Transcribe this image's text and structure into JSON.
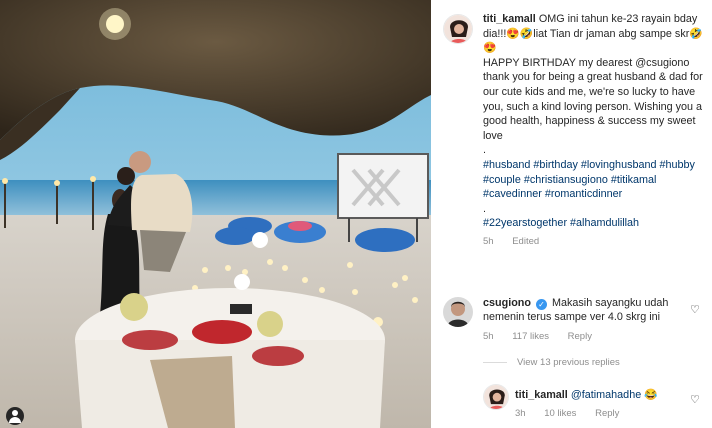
{
  "post": {
    "username": "titi_kamall",
    "caption_lines": [
      "OMG ini tahun ke-23 rayain bday dia!!!😍🤣liat Tian dr jaman abg sampe skr🤣😍",
      "HAPPY BIRTHDAY  my dearest @csugiono thank you for being a great husband & dad for our cute kids and me, we're so lucky to have you, such a kind loving person. Wishing you a good health, happiness & success my sweet love",
      "."
    ],
    "hashtags": "#husband #birthday #lovinghusband #hubby #couple #christiansugiono #titikamal #cavedinner #romanticdinner",
    "hashtags2": ".",
    "hashtags3": "#22yearstogether #alhamdulillah",
    "time": "5h",
    "edited": "Edited"
  },
  "comments": [
    {
      "username": "csugiono",
      "verified": true,
      "text": "Makasih sayangku udah nemenin terus sampe ver 4.0 skrg ini",
      "time": "5h",
      "likes": "117 likes",
      "reply": "Reply"
    }
  ],
  "view_replies": "View 13 previous replies",
  "reply": {
    "username": "titi_kamall",
    "mention": "@fatimahadhe",
    "emoji": "😂",
    "time": "3h",
    "likes": "10 likes",
    "reply": "Reply"
  },
  "icons": {
    "heart": "heart-outline-icon",
    "verified": "verified-badge-icon",
    "tagged": "tagged-user-icon"
  },
  "colors": {
    "link": "#00376b",
    "verified": "#3897f0",
    "meta": "#8e8e8e"
  }
}
